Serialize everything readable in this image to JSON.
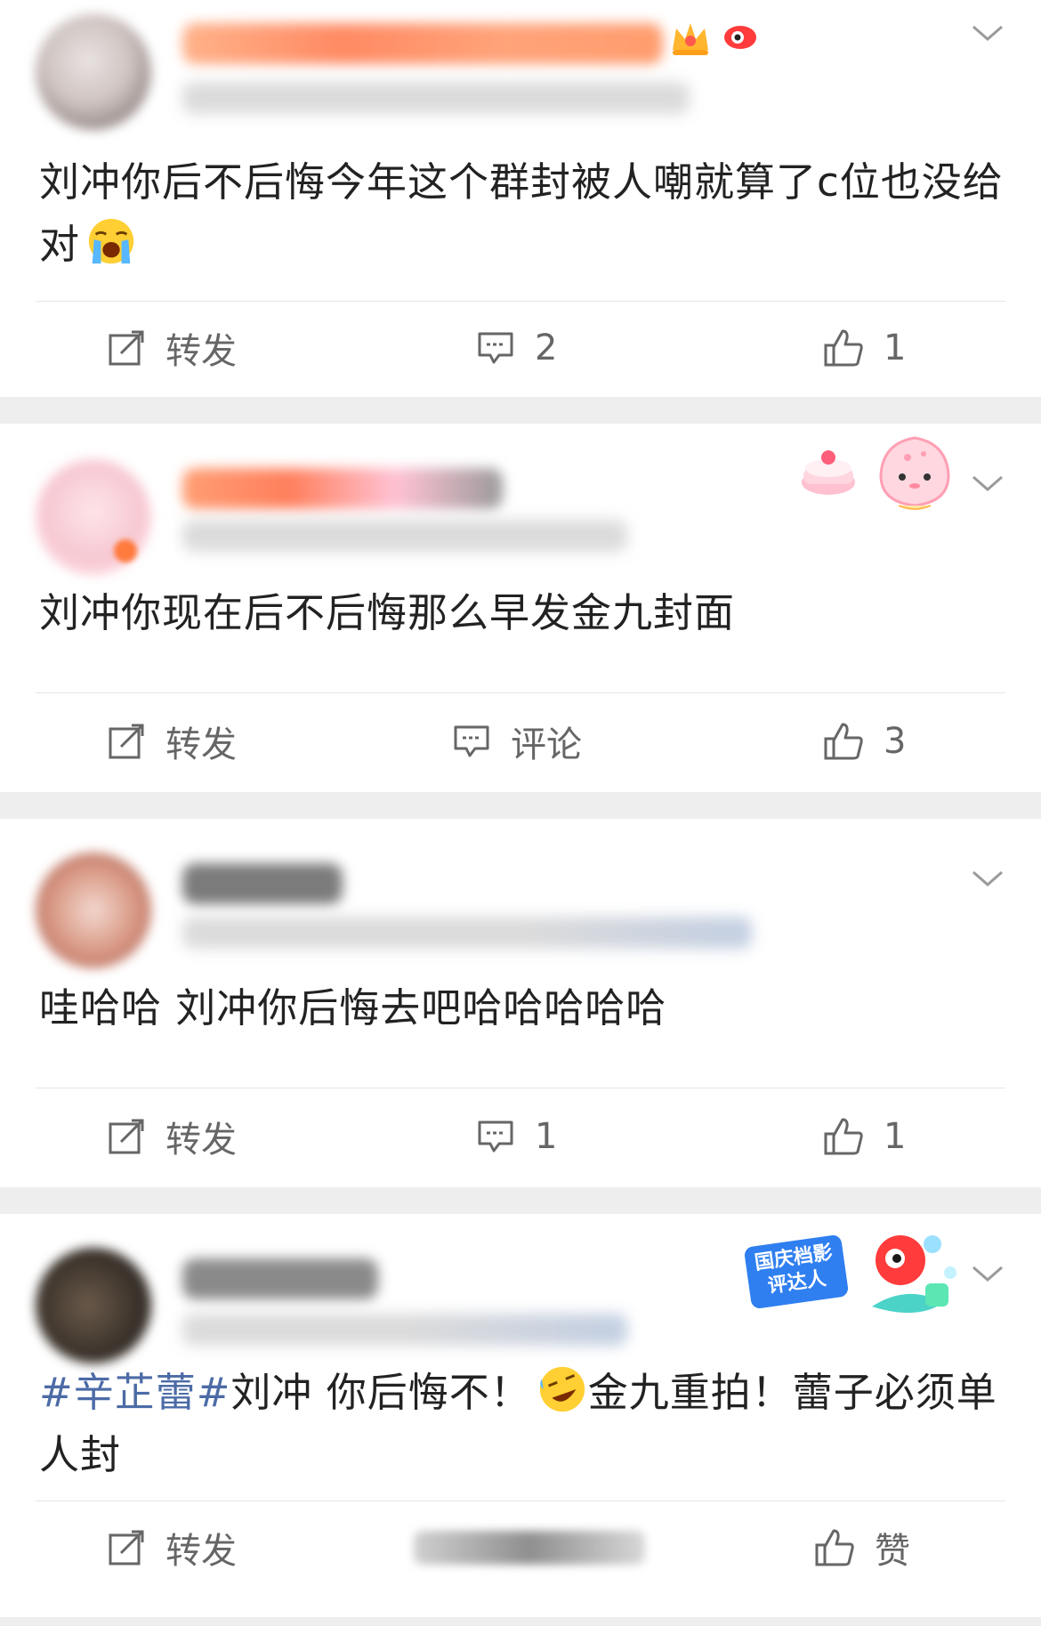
{
  "colors": {
    "background": "#eeeeee",
    "card": "#ffffff",
    "text": "#222222",
    "muted": "#666666",
    "hashtag": "#4c6ba6"
  },
  "posts": [
    {
      "text": "刘冲你后不后悔今年这个群封被人嘲就算了c位也没给对",
      "emoji": "crying-face-icon",
      "actions": {
        "forward": "转发",
        "comment": "2",
        "like": "1"
      }
    },
    {
      "text": "刘冲你现在后不后悔那么早发金九封面",
      "actions": {
        "forward": "转发",
        "comment": "评论",
        "like": "3"
      }
    },
    {
      "text": "哇哈哈 刘冲你后悔去吧哈哈哈哈哈",
      "actions": {
        "forward": "转发",
        "comment": "1",
        "like": "1"
      }
    },
    {
      "hashtag": "#辛芷蕾#",
      "text_a": "刘冲 你后悔不！",
      "emoji": "rofl-face-icon",
      "text_b": "金九重拍！蕾子必须单人封",
      "badge": "国庆档影评达人",
      "actions": {
        "forward": "转发",
        "comment": "",
        "like": "赞"
      }
    }
  ]
}
